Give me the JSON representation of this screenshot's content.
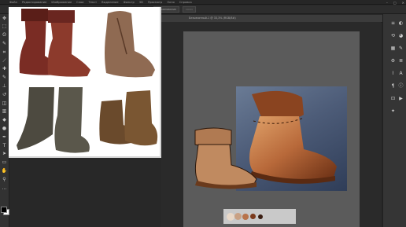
{
  "app": {
    "name": "Adobe Photoshop"
  },
  "menu": {
    "items": [
      "Файл",
      "Редактирование",
      "Изображение",
      "Слои",
      "Текст",
      "Выделение",
      "Фильтр",
      "3D",
      "Просмотр",
      "Окно",
      "Справка"
    ]
  },
  "window_controls": {
    "minimize": "–",
    "maximize": "□",
    "close": "✕"
  },
  "options_bar": {
    "transform_label": "Показ. упр. элем.",
    "align_label": "Выравнивание",
    "auto_select_label": "Автовыбор"
  },
  "document": {
    "tab_label": "Безымянный-1 @ 33,3% (RGB/8#)"
  },
  "tools": [
    {
      "name": "move-tool-icon",
      "glyph": "✥"
    },
    {
      "name": "marquee-tool-icon",
      "glyph": "⬚"
    },
    {
      "name": "lasso-tool-icon",
      "glyph": "ʘ"
    },
    {
      "name": "quick-select-tool-icon",
      "glyph": "✎"
    },
    {
      "name": "crop-tool-icon",
      "glyph": "⌗"
    },
    {
      "name": "eyedropper-tool-icon",
      "glyph": "⟋"
    },
    {
      "name": "healing-tool-icon",
      "glyph": "✚"
    },
    {
      "name": "brush-tool-icon",
      "glyph": "✎"
    },
    {
      "name": "stamp-tool-icon",
      "glyph": "⊥"
    },
    {
      "name": "history-brush-tool-icon",
      "glyph": "↺"
    },
    {
      "name": "eraser-tool-icon",
      "glyph": "◫"
    },
    {
      "name": "gradient-tool-icon",
      "glyph": "▥"
    },
    {
      "name": "blur-tool-icon",
      "glyph": "◆"
    },
    {
      "name": "dodge-tool-icon",
      "glyph": "●"
    },
    {
      "name": "pen-tool-icon",
      "glyph": "✒"
    },
    {
      "name": "type-tool-icon",
      "glyph": "T"
    },
    {
      "name": "path-select-tool-icon",
      "glyph": "➤"
    },
    {
      "name": "shape-tool-icon",
      "glyph": "▭"
    },
    {
      "name": "hand-tool-icon",
      "glyph": "✋"
    },
    {
      "name": "zoom-tool-icon",
      "glyph": "⚲"
    },
    {
      "name": "more-tools-icon",
      "glyph": "…"
    }
  ],
  "right_dock": [
    {
      "name": "layers-panel-icon",
      "glyph": "≡"
    },
    {
      "name": "adjustments-panel-icon",
      "glyph": "◐"
    },
    {
      "name": "history-panel-icon",
      "glyph": "⟲"
    },
    {
      "name": "color-panel-icon",
      "glyph": "◕"
    },
    {
      "name": "swatches-panel-icon",
      "glyph": "▦"
    },
    {
      "name": "brush-panel-icon",
      "glyph": "✎"
    },
    {
      "name": "properties-panel-icon",
      "glyph": "⚙"
    },
    {
      "name": "channels-panel-icon",
      "glyph": "≣"
    },
    {
      "name": "paths-panel-icon",
      "glyph": "⌇"
    },
    {
      "name": "character-panel-icon",
      "glyph": "A"
    },
    {
      "name": "paragraph-panel-icon",
      "glyph": "¶"
    },
    {
      "name": "info-panel-icon",
      "glyph": "ⓘ"
    },
    {
      "name": "navigator-panel-icon",
      "glyph": "⊡"
    },
    {
      "name": "actions-panel-icon",
      "glyph": "▶"
    },
    {
      "name": "tool-presets-panel-icon",
      "glyph": "✦"
    }
  ],
  "palette_colors": [
    "#e8d8c8",
    "#c9a184",
    "#b8734a",
    "#7b3a1c",
    "#3a1e12"
  ],
  "colors": {
    "foreground": "#000000",
    "background": "#ffffff",
    "workspace": "#2a2a2a",
    "canvas": "#5b5b5b",
    "painting_bg": "#4d5c78"
  }
}
